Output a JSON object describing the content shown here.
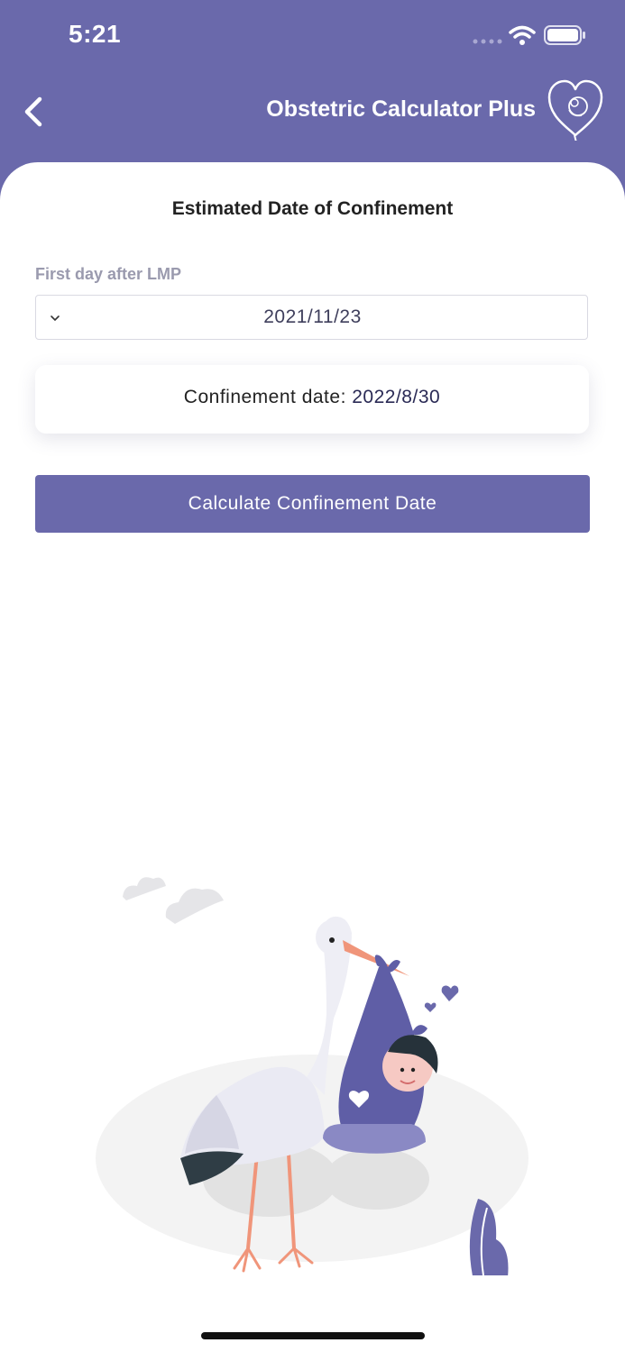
{
  "status_bar": {
    "time": "5:21"
  },
  "nav": {
    "title": "Obstetric Calculator Plus"
  },
  "form": {
    "section_title": "Estimated Date of Confinement",
    "lmp_label": "First day after LMP",
    "lmp_value": "2021/11/23",
    "result_label": "Confinement date: ",
    "result_value": "2022/8/30",
    "calculate_label": "Calculate Confinement Date"
  },
  "icons": {
    "back": "chevron-left-icon",
    "logo": "heart-baby-icon",
    "dropdown": "chevron-down-icon",
    "wifi": "wifi-icon",
    "battery": "battery-icon",
    "illustration": "stork-baby-illustration"
  },
  "colors": {
    "primary": "#6a69ab",
    "background": "#ffffff",
    "label": "#9a9aae",
    "text": "#222222"
  }
}
